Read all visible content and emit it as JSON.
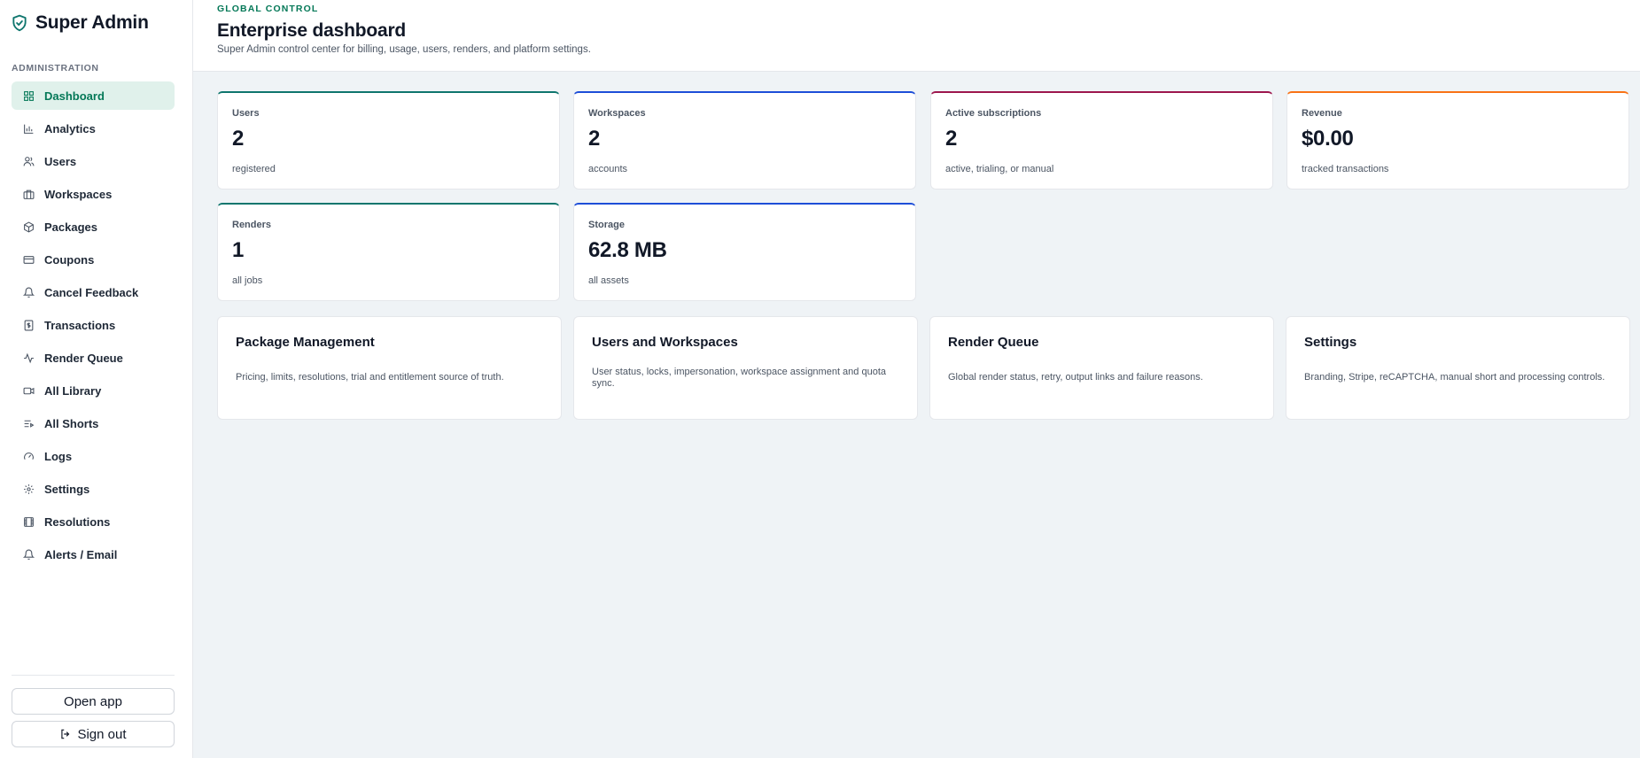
{
  "brand": {
    "name": "Super Admin"
  },
  "sidebar": {
    "section_label": "ADMINISTRATION",
    "items": [
      {
        "label": "Dashboard",
        "icon": "layout-grid-icon",
        "active": true
      },
      {
        "label": "Analytics",
        "icon": "bar-chart-icon"
      },
      {
        "label": "Users",
        "icon": "users-icon"
      },
      {
        "label": "Workspaces",
        "icon": "briefcase-icon"
      },
      {
        "label": "Packages",
        "icon": "package-icon"
      },
      {
        "label": "Coupons",
        "icon": "credit-card-icon"
      },
      {
        "label": "Cancel Feedback",
        "icon": "bell-icon"
      },
      {
        "label": "Transactions",
        "icon": "receipt-dollar-icon"
      },
      {
        "label": "Render Queue",
        "icon": "activity-icon"
      },
      {
        "label": "All Library",
        "icon": "video-icon"
      },
      {
        "label": "All Shorts",
        "icon": "list-video-icon"
      },
      {
        "label": "Logs",
        "icon": "gauge-icon"
      },
      {
        "label": "Settings",
        "icon": "gear-icon"
      },
      {
        "label": "Resolutions",
        "icon": "film-icon"
      },
      {
        "label": "Alerts / Email",
        "icon": "bell-icon"
      }
    ],
    "open_app": "Open app",
    "sign_out": "Sign out"
  },
  "header": {
    "eyebrow": "GLOBAL CONTROL",
    "title": "Enterprise dashboard",
    "subtitle": "Super Admin control center for billing, usage, users, renders, and platform settings."
  },
  "stats": [
    {
      "label": "Users",
      "value": "2",
      "note": "registered",
      "accent": "#0f766e"
    },
    {
      "label": "Workspaces",
      "value": "2",
      "note": "accounts",
      "accent": "#1d4ed8"
    },
    {
      "label": "Active subscriptions",
      "value": "2",
      "note": "active, trialing, or manual",
      "accent": "#9d174d"
    },
    {
      "label": "Revenue",
      "value": "$0.00",
      "note": "tracked transactions",
      "accent": "#f97316"
    },
    {
      "label": "Renders",
      "value": "1",
      "note": "all jobs",
      "accent": "#0f766e"
    },
    {
      "label": "Storage",
      "value": "62.8 MB",
      "note": "all assets",
      "accent": "#1d4ed8"
    }
  ],
  "cards": [
    {
      "title": "Package Management",
      "desc": "Pricing, limits, resolutions, trial and entitlement source of truth."
    },
    {
      "title": "Users and Workspaces",
      "desc": "User status, locks, impersonation, workspace assignment and quota sync."
    },
    {
      "title": "Render Queue",
      "desc": "Global render status, retry, output links and failure reasons."
    },
    {
      "title": "Settings",
      "desc": "Branding, Stripe, reCAPTCHA, manual short and processing controls."
    }
  ]
}
